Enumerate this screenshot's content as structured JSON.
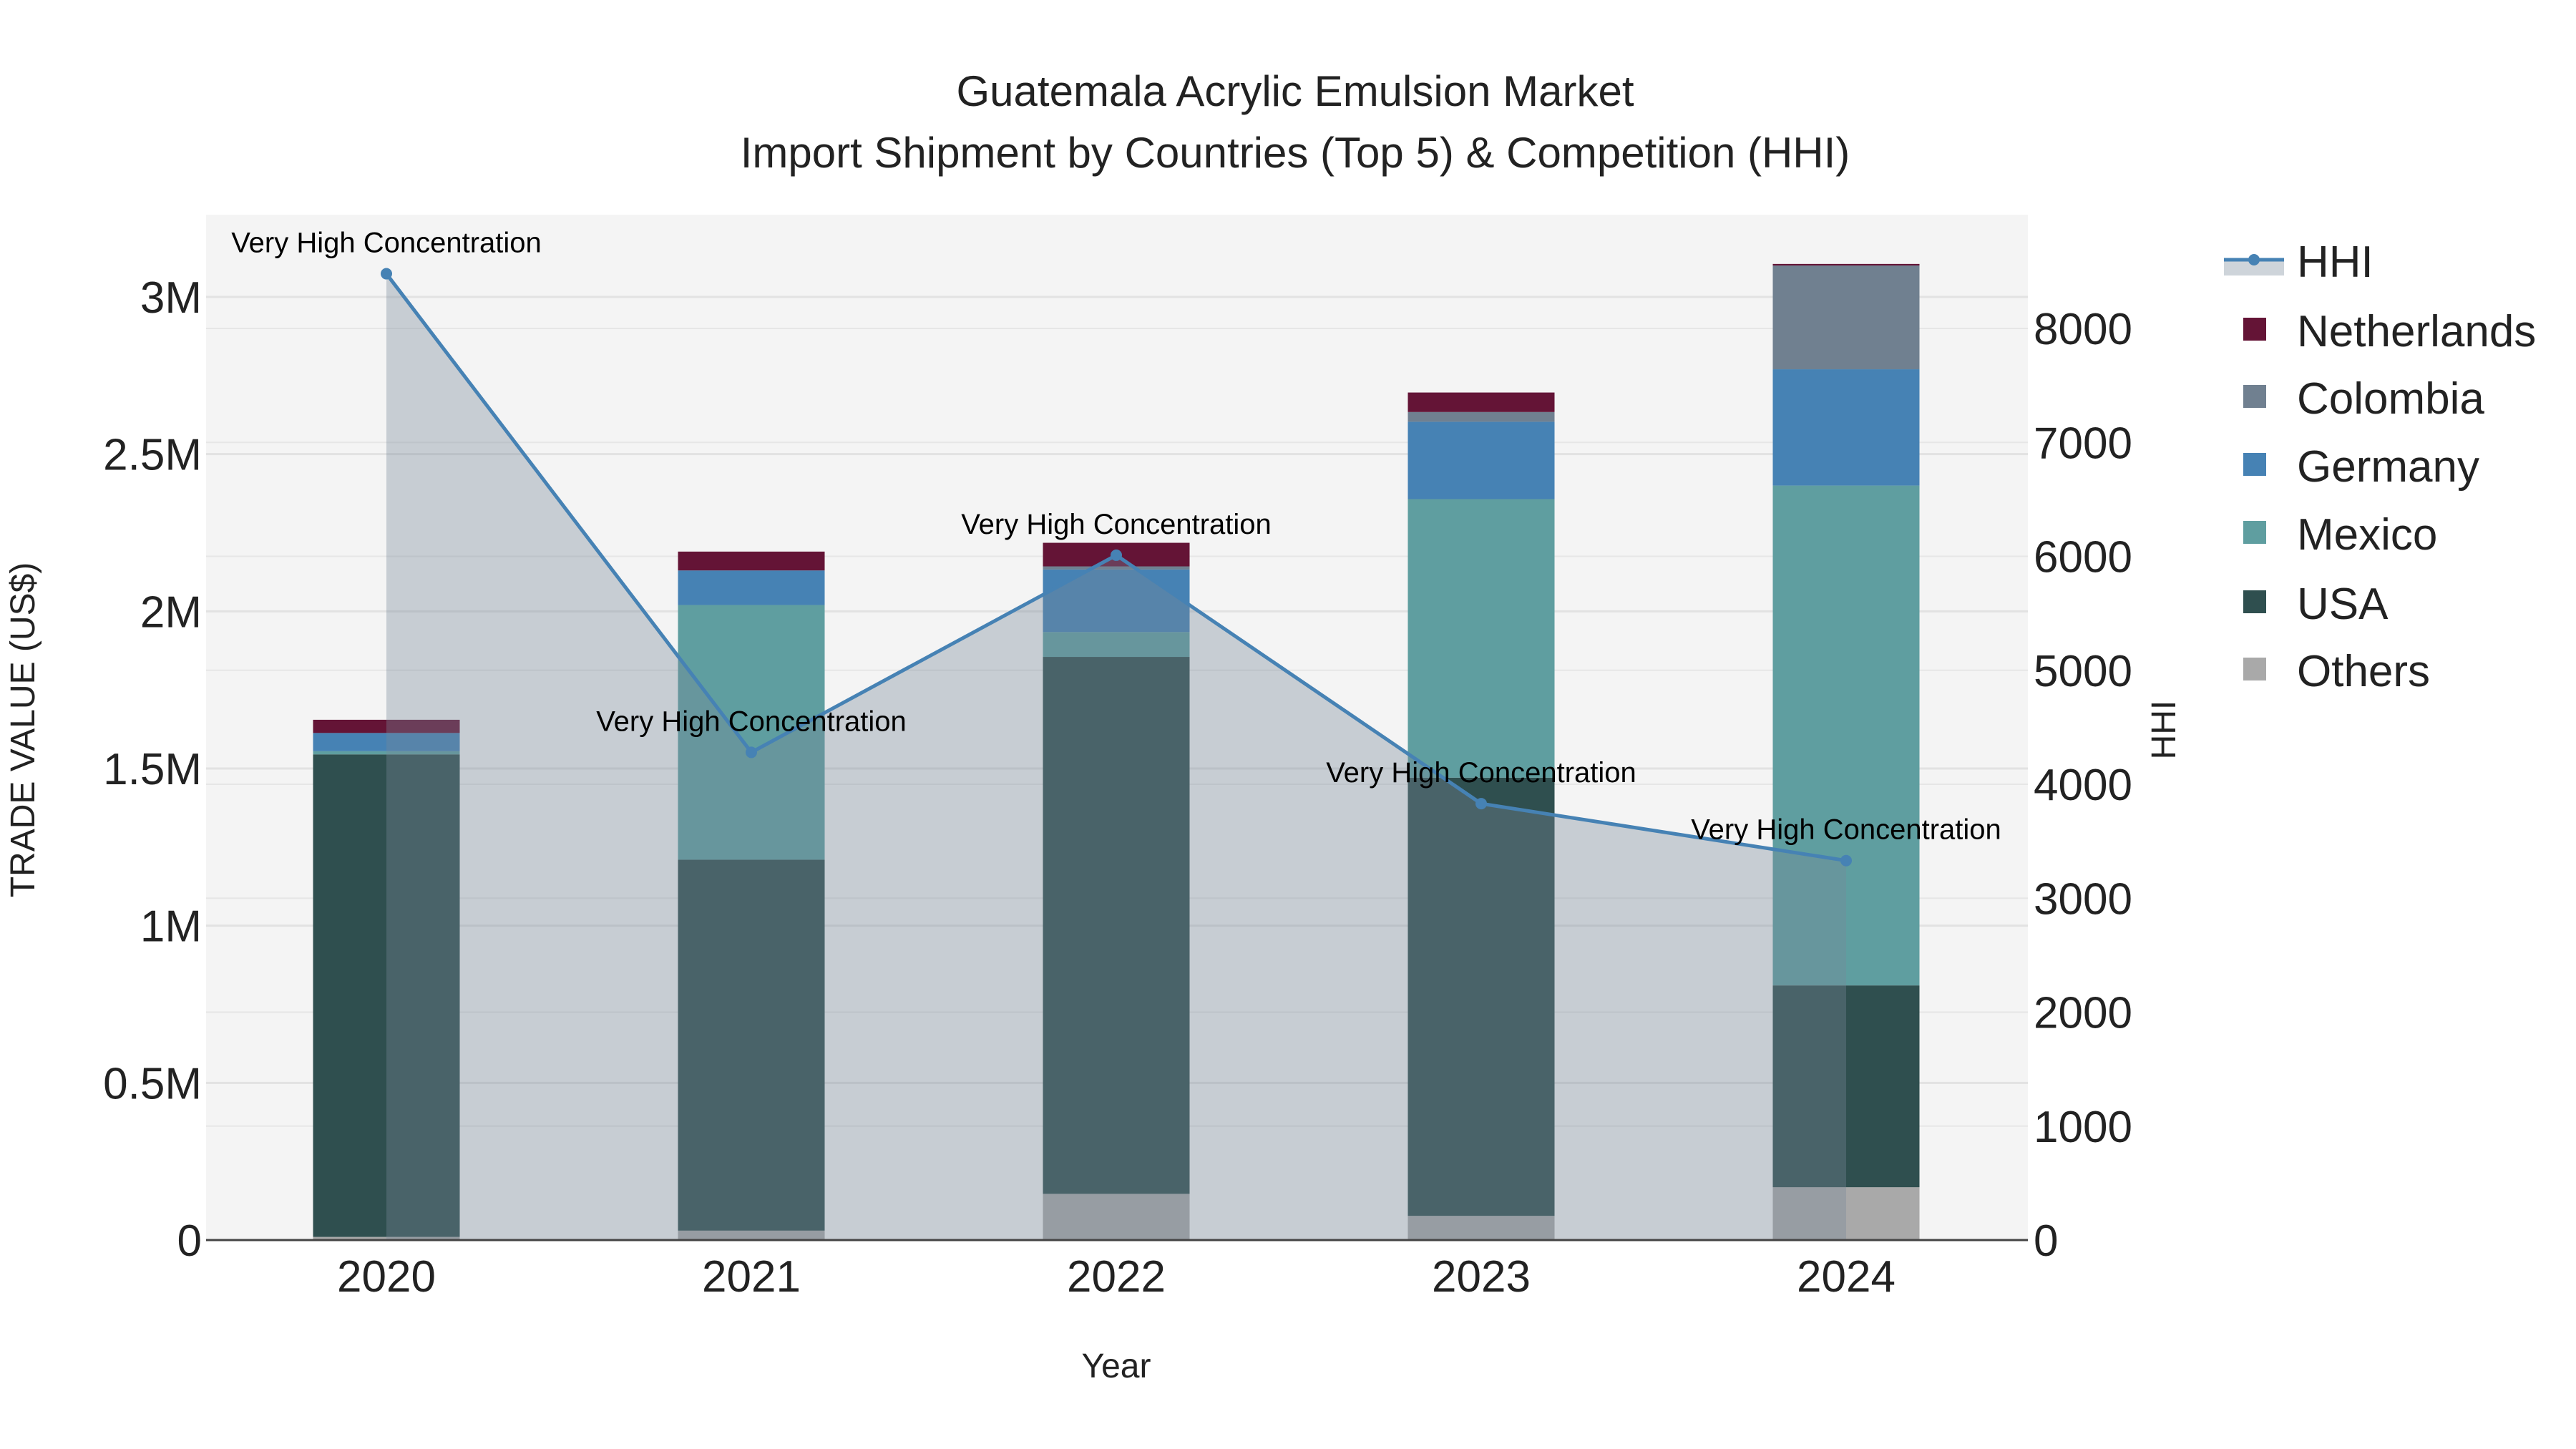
{
  "chart_data": {
    "type": "bar",
    "barmode": "stack",
    "title": "Guatemala Acrylic Emulsion Market",
    "subtitle": "Import Shipment by Countries (Top 5) & Competition (HHI)",
    "xlabel": "Year",
    "ylabel": "TRADE VALUE (US$)",
    "y2label": "HHI",
    "categories": [
      "2020",
      "2021",
      "2022",
      "2023",
      "2024"
    ],
    "ylim": [
      0,
      3250000
    ],
    "y_ticks": [
      0,
      500000,
      1000000,
      1500000,
      2000000,
      2500000,
      3000000
    ],
    "y_tick_labels": [
      "0",
      "0.5M",
      "1M",
      "1.5M",
      "2M",
      "2.5M",
      "3M"
    ],
    "y2lim": [
      0,
      8900
    ],
    "y2_ticks": [
      0,
      1000,
      2000,
      3000,
      4000,
      5000,
      6000,
      7000,
      8000
    ],
    "y2_tick_labels": [
      "0",
      "1000",
      "2000",
      "3000",
      "4000",
      "5000",
      "6000",
      "7000",
      "8000"
    ],
    "series": [
      {
        "name": "Others",
        "color": "#a9a9a9",
        "values": [
          10000,
          30000,
          147000,
          77000,
          168000
        ]
      },
      {
        "name": "USA",
        "color": "#2f4f4f",
        "values": [
          1535000,
          1180000,
          1708000,
          1394000,
          642000
        ]
      },
      {
        "name": "Mexico",
        "color": "#5f9ea0",
        "values": [
          10000,
          810000,
          79000,
          886000,
          1590000
        ]
      },
      {
        "name": "Germany",
        "color": "#4682b4",
        "values": [
          58000,
          110000,
          199000,
          246000,
          370000
        ]
      },
      {
        "name": "Colombia",
        "color": "#708090",
        "values": [
          0,
          0,
          10000,
          31000,
          330000
        ]
      },
      {
        "name": "Netherlands",
        "color": "#641436",
        "values": [
          42000,
          60000,
          75000,
          62000,
          5000
        ]
      }
    ],
    "hhi": {
      "name": "HHI",
      "color": "#4682b4",
      "fill": "rgba(119,136,153,0.36)",
      "values": [
        8480,
        4280,
        6010,
        3830,
        3330
      ],
      "annotations": [
        "Very High Concentration",
        "Very High Concentration",
        "Very High Concentration",
        "Very High Concentration",
        "Very High Concentration"
      ]
    },
    "legend": {
      "placement": "right",
      "order": [
        "HHI",
        "Netherlands",
        "Colombia",
        "Germany",
        "Mexico",
        "USA",
        "Others"
      ]
    },
    "grid": true
  }
}
